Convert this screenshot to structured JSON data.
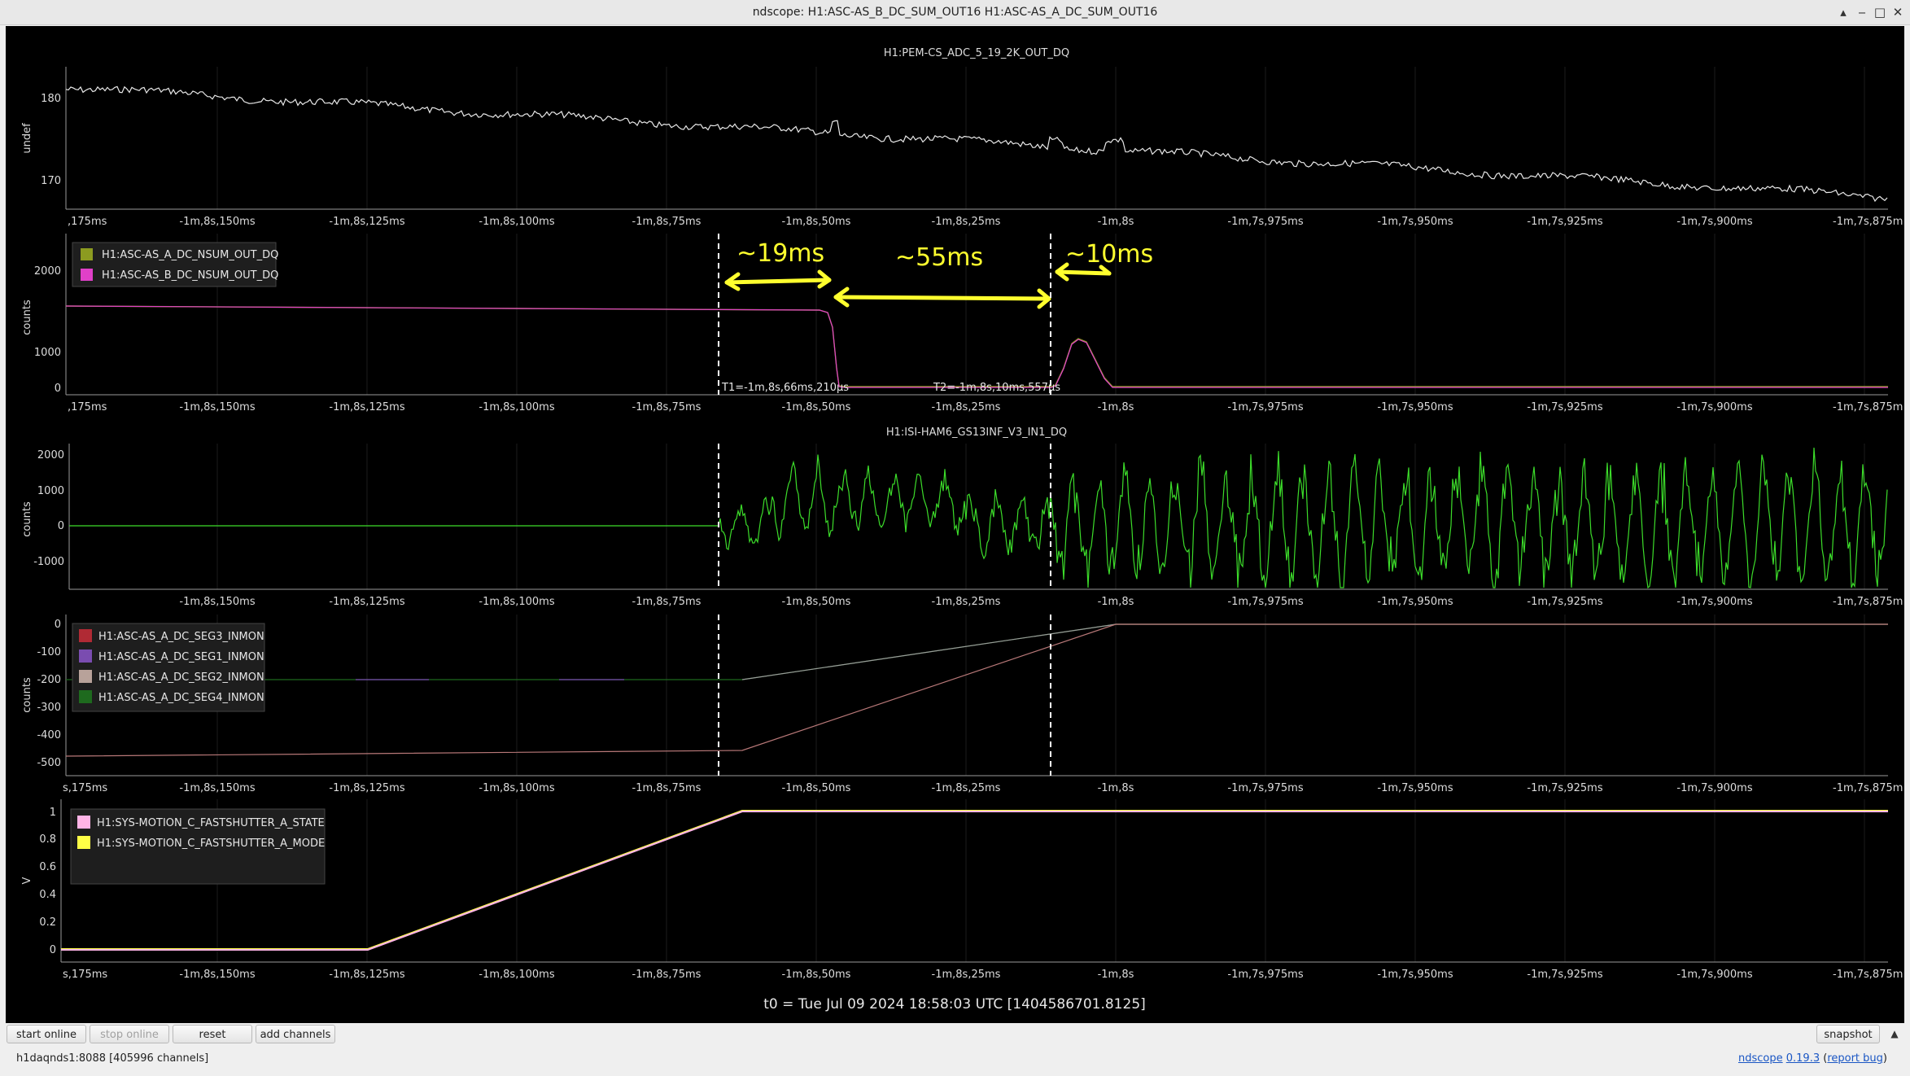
{
  "window": {
    "title": "ndscope: H1:ASC-AS_B_DC_SUM_OUT16 H1:ASC-AS_A_DC_SUM_OUT16",
    "buttons": {
      "minimize": "‒",
      "maximize": "□",
      "restore": "▴",
      "close": "✕"
    }
  },
  "x_tick_labels": [
    ",175ms",
    "-1m,8s,150ms",
    "-1m,8s,125ms",
    "-1m,8s,100ms",
    "-1m,8s,75ms",
    "-1m,8s,50ms",
    "-1m,8s,25ms",
    "-1m,8s",
    "-1m,7s,975ms",
    "-1m,7s,950ms",
    "-1m,7s,925ms",
    "-1m,7s,900ms",
    "-1m,7s,875m"
  ],
  "x_tick_labels_plot4": [
    "s,175ms",
    "-1m,8s,150ms",
    "-1m,8s,125ms",
    "-1m,8s,100ms",
    "-1m,8s,75ms",
    "-1m,8s,50ms",
    "-1m,8s,25ms",
    "-1m,8s",
    "-1m,7s,975ms",
    "-1m,7s,950ms",
    "-1m,7s,925ms",
    "-1m,7s,900ms",
    "-1m,7s,875m"
  ],
  "x_tick_labels_plot5": [
    "s,175ms",
    "-1m,8s,150ms",
    "-1m,8s,125ms",
    "-1m,8s,100ms",
    "-1m,8s,75ms",
    "-1m,8s,50ms",
    "-1m,8s,25ms",
    "-1m,8s",
    "-1m,7s,975ms",
    "-1m,7s,950ms",
    "-1m,7s,925ms",
    "-1m,7s,900ms",
    "-1m,7s,875m"
  ],
  "x_tick_labels_plot3": [
    "-1m,8s,150ms",
    "-1m,8s,125ms",
    "-1m,8s,100ms",
    "-1m,8s,75ms",
    "-1m,8s,50ms",
    "-1m,8s,25ms",
    "-1m,8s",
    "-1m,7s,975ms",
    "-1m,7s,950ms",
    "-1m,7s,925ms",
    "-1m,7s,900ms",
    "-1m,7s,875m"
  ],
  "plots": [
    {
      "title": "H1:PEM-CS_ADC_5_19_2K_OUT_DQ",
      "ylabel": "undef",
      "yticks": [
        "180",
        "170"
      ],
      "legend": []
    },
    {
      "title": "",
      "ylabel": "counts",
      "yticks": [
        "2000",
        "1000",
        "0"
      ],
      "legend": [
        {
          "label": "H1:ASC-AS_A_DC_NSUM_OUT_DQ",
          "color": "#8c9b20"
        },
        {
          "label": "H1:ASC-AS_B_DC_NSUM_OUT_DQ",
          "color": "#e040c8"
        }
      ]
    },
    {
      "title": "H1:ISI-HAM6_GS13INF_V3_IN1_DQ",
      "ylabel": "counts",
      "yticks": [
        "2000",
        "1000",
        "0",
        "-1000"
      ],
      "legend": []
    },
    {
      "title": "",
      "ylabel": "counts",
      "yticks": [
        "0",
        "-100",
        "-200",
        "-300",
        "-400",
        "-500"
      ],
      "legend": [
        {
          "label": "H1:ASC-AS_A_DC_SEG3_INMON",
          "color": "#b02a34"
        },
        {
          "label": "H1:ASC-AS_A_DC_SEG1_INMON",
          "color": "#7a4cb0"
        },
        {
          "label": "H1:ASC-AS_A_DC_SEG2_INMON",
          "color": "#b8a29a"
        },
        {
          "label": "H1:ASC-AS_A_DC_SEG4_INMON",
          "color": "#1e6a1e"
        }
      ]
    },
    {
      "title": "",
      "ylabel": "V",
      "yticks": [
        "1",
        "0.8",
        "0.6",
        "0.4",
        "0.2",
        "0"
      ],
      "legend": [
        {
          "label": "H1:SYS-MOTION_C_FASTSHUTTER_A_STATE",
          "color": "#ffb4e6"
        },
        {
          "label": "H1:SYS-MOTION_C_FASTSHUTTER_A_MODE",
          "color": "#ffff46"
        }
      ]
    }
  ],
  "cursors": {
    "t1_label": "T1=-1m,8s,66ms,210μs",
    "t2_label": "T2=-1m,8s,10ms,557μs"
  },
  "annotations": [
    "~19ms",
    "~55ms",
    "~10ms"
  ],
  "t0_text": "t0 = Tue Jul 09 2024 18:58:03 UTC [1404586701.8125]",
  "buttons": {
    "start_online": "start online",
    "stop_online": "stop online",
    "reset": "reset",
    "add_channels": "add channels",
    "snapshot": "snapshot"
  },
  "status_text": "h1daqnds1:8088  [405996 channels]",
  "footer": {
    "app": "ndscope",
    "version": "0.19.3",
    "report": "report bug"
  }
}
